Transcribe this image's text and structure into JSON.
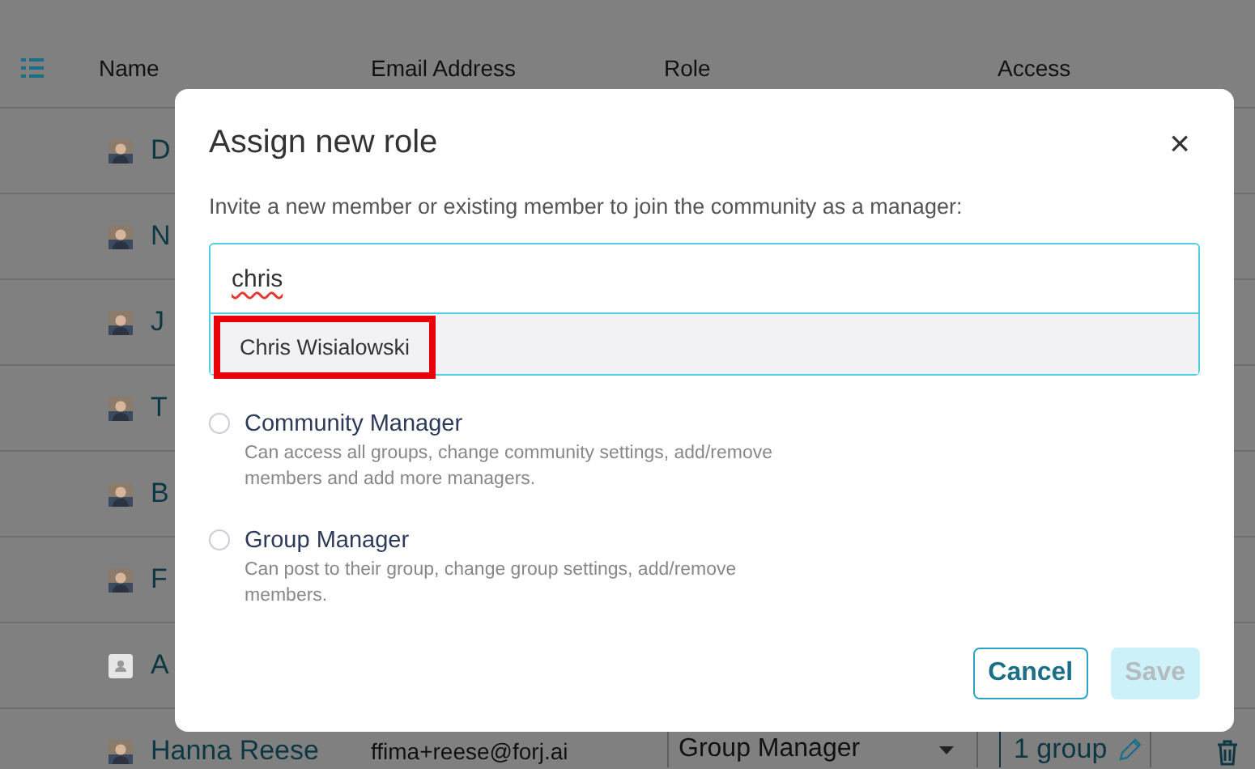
{
  "table": {
    "columns": [
      "Name",
      "Email Address",
      "Role",
      "Access"
    ],
    "rows": [
      {
        "name": "D",
        "kind": "photo"
      },
      {
        "name": "N",
        "kind": "photo"
      },
      {
        "name": "J",
        "kind": "photo"
      },
      {
        "name": "T",
        "kind": "photo"
      },
      {
        "name": "B",
        "kind": "photo"
      },
      {
        "name": "F",
        "kind": "photo"
      },
      {
        "name": "A",
        "kind": "placeholder"
      },
      {
        "name": "Hanna Reese",
        "kind": "photo",
        "email": "ffima+reese@forj.ai",
        "role": "Group Manager",
        "access": "1 group"
      }
    ]
  },
  "dialog": {
    "title": "Assign new role",
    "close": "×",
    "description": "Invite a new member or existing member to join the community as a manager:",
    "search": {
      "value": "chris",
      "spellcheck_error": true
    },
    "suggestions": [
      {
        "label": "Chris Wisialowski",
        "highlighted": true
      }
    ],
    "roles": [
      {
        "label": "Community Manager",
        "description": "Can access all groups, change community settings, add/remove members and add more managers.",
        "selected": false
      },
      {
        "label": "Group Manager",
        "description": "Can post to their group, change group settings, add/remove members.",
        "selected": false
      }
    ],
    "buttons": [
      {
        "label": "Cancel",
        "kind": "secondary",
        "disabled": false
      },
      {
        "label": "Save",
        "kind": "primary",
        "disabled": true
      }
    ]
  }
}
